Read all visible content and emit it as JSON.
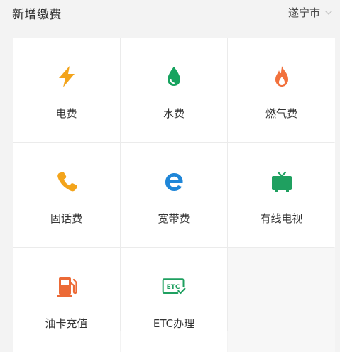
{
  "header": {
    "title": "新增缴费",
    "city": "遂宁市"
  },
  "services": [
    {
      "label": "电费",
      "icon": "lightning-icon",
      "color": "#f3a41b"
    },
    {
      "label": "水费",
      "icon": "water-drop-icon",
      "color": "#17a35f"
    },
    {
      "label": "燃气费",
      "icon": "flame-icon",
      "color": "#f2713c"
    },
    {
      "label": "固话费",
      "icon": "phone-icon",
      "color": "#f3a41b"
    },
    {
      "label": "宽带费",
      "icon": "browser-e-icon",
      "color": "#1f86d8"
    },
    {
      "label": "有线电视",
      "icon": "tv-icon",
      "color": "#1fa060"
    },
    {
      "label": "油卡充值",
      "icon": "fuel-pump-icon",
      "color": "#ec6a36"
    },
    {
      "label": "ETC办理",
      "icon": "etc-card-icon",
      "color": "#1fa060"
    }
  ]
}
